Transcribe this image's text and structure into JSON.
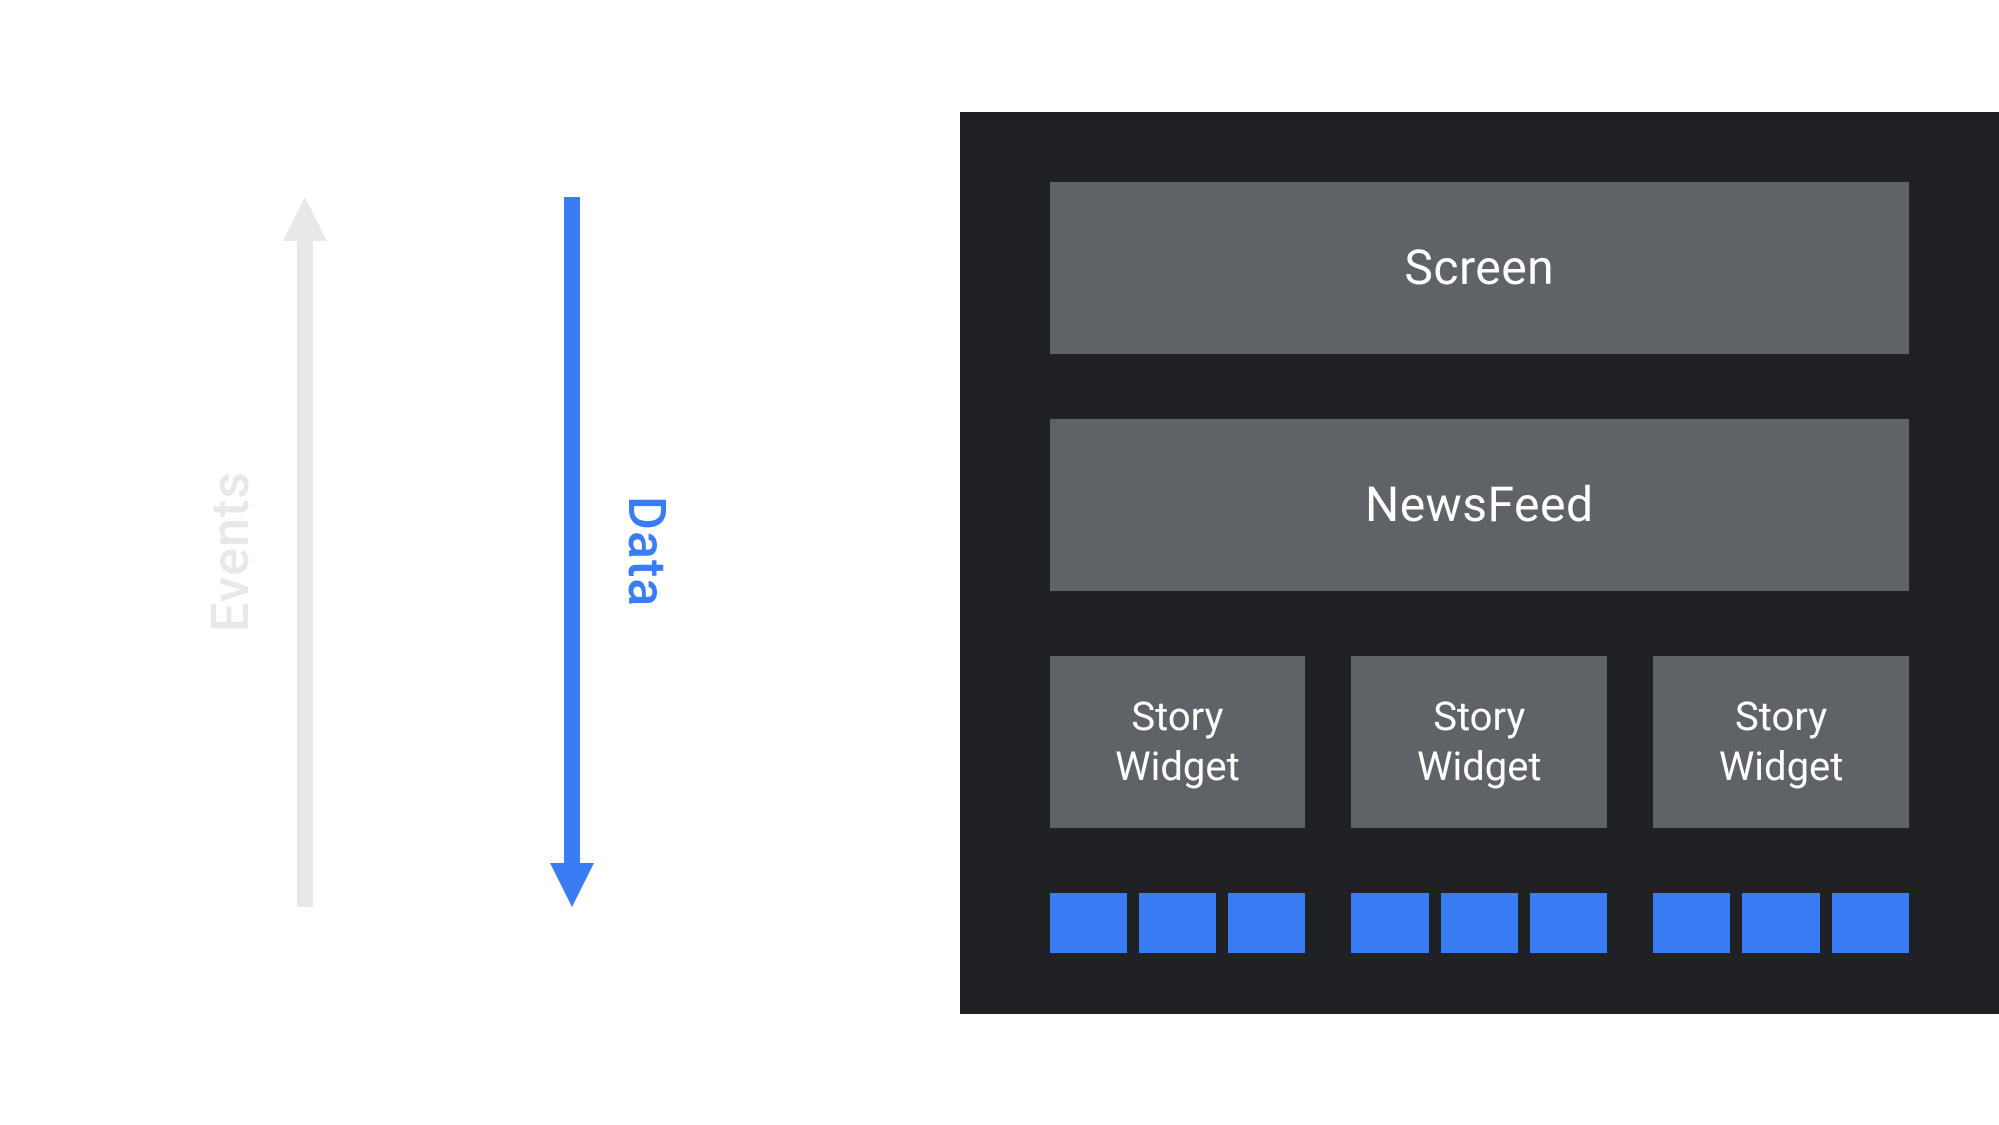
{
  "left": {
    "events_label": "Events",
    "data_label": "Data"
  },
  "right": {
    "screen_label": "Screen",
    "newsfeed_label": "NewsFeed",
    "widgets": [
      {
        "label": "Story\nWidget"
      },
      {
        "label": "Story\nWidget"
      },
      {
        "label": "Story\nWidget"
      }
    ],
    "small_rects_per_widget": 3
  },
  "colors": {
    "arrow_events": "#e8e8e8",
    "arrow_data": "#3a7cf4",
    "box_bg": "#5f6368",
    "small_rect": "#3a7cf4",
    "dark_panel": "#202124",
    "text_light": "#ffffff"
  }
}
